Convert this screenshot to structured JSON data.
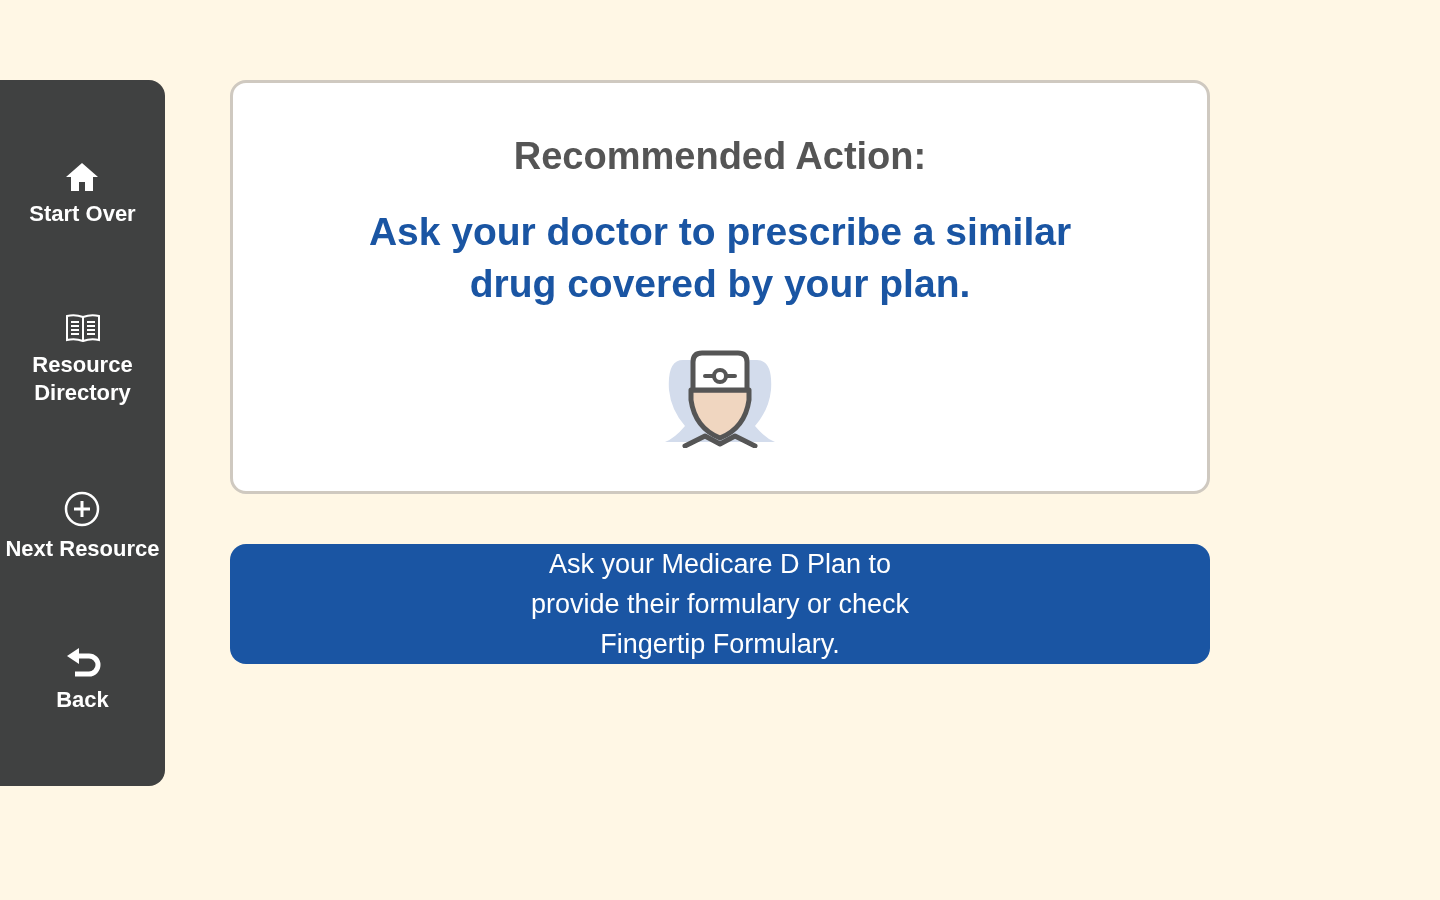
{
  "sidebar": {
    "items": [
      {
        "kind": "home",
        "label": "Start Over"
      },
      {
        "kind": "book",
        "label": "Resource Directory"
      },
      {
        "kind": "plus",
        "label": "Next Resource"
      },
      {
        "kind": "back",
        "label": "Back"
      }
    ]
  },
  "card": {
    "heading": "Recommended Action:",
    "message": "Ask your doctor to prescribe a similar drug covered by your plan."
  },
  "action_button": {
    "label": "Ask your Medicare D Plan to provide their formulary or check Fingertip Formulary."
  }
}
